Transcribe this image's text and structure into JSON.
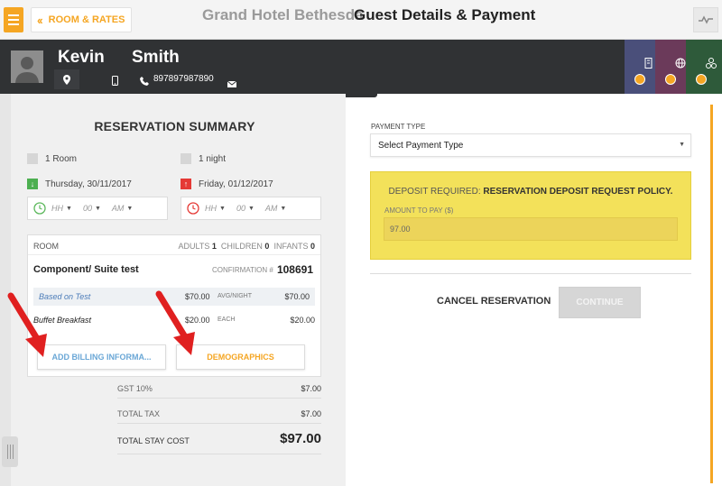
{
  "topbar": {
    "back_label": "ROOM & RATES",
    "hotel_name": "Grand Hotel Bethesda",
    "page_title": "Guest Details & Payment"
  },
  "guest": {
    "first_name": "Kevin",
    "last_name": "Smith",
    "phone": "897897987890"
  },
  "summary": {
    "title": "RESERVATION SUMMARY",
    "rooms": "1 Room",
    "nights": "1 night",
    "checkin": "Thursday, 30/11/2017",
    "checkout": "Friday, 01/12/2017",
    "time_hh": "HH",
    "time_mm": "00",
    "time_ampm": "AM"
  },
  "room": {
    "header_label": "ROOM",
    "adults_label": "ADULTS",
    "adults": "1",
    "children_label": "CHILDREN",
    "children": "0",
    "infants_label": "INFANTS",
    "infants": "0",
    "name": "Component/ Suite test",
    "confirmation_label": "CONFIRMATION #",
    "confirmation": "108691",
    "rate_name": "Based on Test",
    "rate_price": "$70.00",
    "rate_unit": "AVG/NIGHT",
    "rate_total": "$70.00",
    "addon_name": "Buffet Breakfast",
    "addon_price": "$20.00",
    "addon_unit": "EACH",
    "addon_total": "$20.00",
    "billing_btn": "ADD BILLING INFORMA...",
    "demographics_btn": "DEMOGRAPHICS"
  },
  "totals": {
    "gst_label": "GST 10%",
    "gst": "$7.00",
    "tax_label": "TOTAL TAX",
    "tax": "$7.00",
    "stay_label": "TOTAL STAY COST",
    "stay": "$97.00"
  },
  "payment": {
    "type_label": "PAYMENT TYPE",
    "type_value": "Select Payment Type",
    "deposit_prefix": "DEPOSIT REQUIRED:",
    "deposit_policy": "RESERVATION DEPOSIT REQUEST POLICY.",
    "amount_label": "AMOUNT TO PAY ($)",
    "amount_value": "97.00",
    "cancel_label": "CANCEL RESERVATION",
    "continue_label": "CONTINUE"
  },
  "colors": {
    "accent": "#f5a623",
    "header_dark": "#303234",
    "deposit_yellow": "#f3e15a",
    "tile_blue": "#4a4f7a",
    "tile_purple": "#6b3a5a",
    "tile_green": "#2e5a3a",
    "arrow_red": "#e02020"
  }
}
